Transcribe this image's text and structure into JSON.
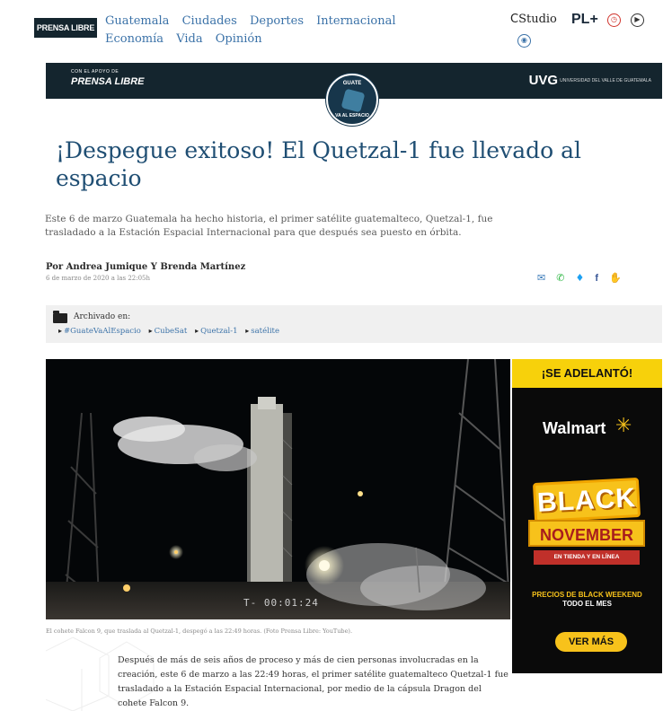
{
  "nav": {
    "logo": "PRENSA LIBRE",
    "links": [
      "Guatemala",
      "Ciudades",
      "Deportes",
      "Internacional",
      "Economía",
      "Vida",
      "Opinión"
    ],
    "studio_label": "Studio",
    "pl_label": "PL+"
  },
  "banner": {
    "apoyo": "CON EL APOYO DE",
    "brand": "PRENSA LIBRE",
    "partner": "UVG",
    "partner_sub": "UNIVERSIDAD DEL VALLE DE GUATEMALA",
    "badge_top": "GUATE",
    "badge_bottom": "VA AL ESPACIO"
  },
  "article": {
    "headline": "¡Despegue exitoso! El Quetzal-1 fue llevado al espacio",
    "dek": "Este 6 de marzo Guatemala ha hecho historia, el primer satélite guatemalteco, Quetzal-1, fue trasladado a la Estación Espacial Internacional para que después sea puesto en órbita.",
    "byline": "Por Andrea Jumique Y Brenda Martínez",
    "date": "6 de marzo de 2020 a las 22:05h",
    "archived_label": "Archivado en:",
    "tags": [
      "#GuateVaAlEspacio",
      "CubeSat",
      "Quetzal-1",
      "satélite"
    ],
    "image_timer": "T- 00:01:24",
    "caption": "El cohete Falcon 9, que traslada al Quetzal-1, despegó a las 22:49 horas. (Foto Prensa Libre: YouTube).",
    "body": "Después de más de seis años de proceso y más de cien personas involucradas en la creación, este 6 de marzo a las 22:49 horas, el primer satélite guatemalteco Quetzal-1 fue trasladado a la Estación Espacial Internacional, por medio de la cápsula Dragon del cohete Falcon 9."
  },
  "ad": {
    "header": "¡SE ADELANTÓ!",
    "brand": "Walmart",
    "black": "BLACK",
    "november": "NOVEMBER",
    "sub": "EN TIENDA Y EN LÍNEA",
    "prices_line1": "PRECIOS DE BLACK WEEKEND",
    "prices_line2": "TODO EL MES",
    "cta": "VER MÁS"
  },
  "colors": {
    "link": "#3b72a8",
    "headline": "#1f4e73",
    "banner_bg": "#14252e",
    "ad_yellow": "#f7c21b"
  }
}
